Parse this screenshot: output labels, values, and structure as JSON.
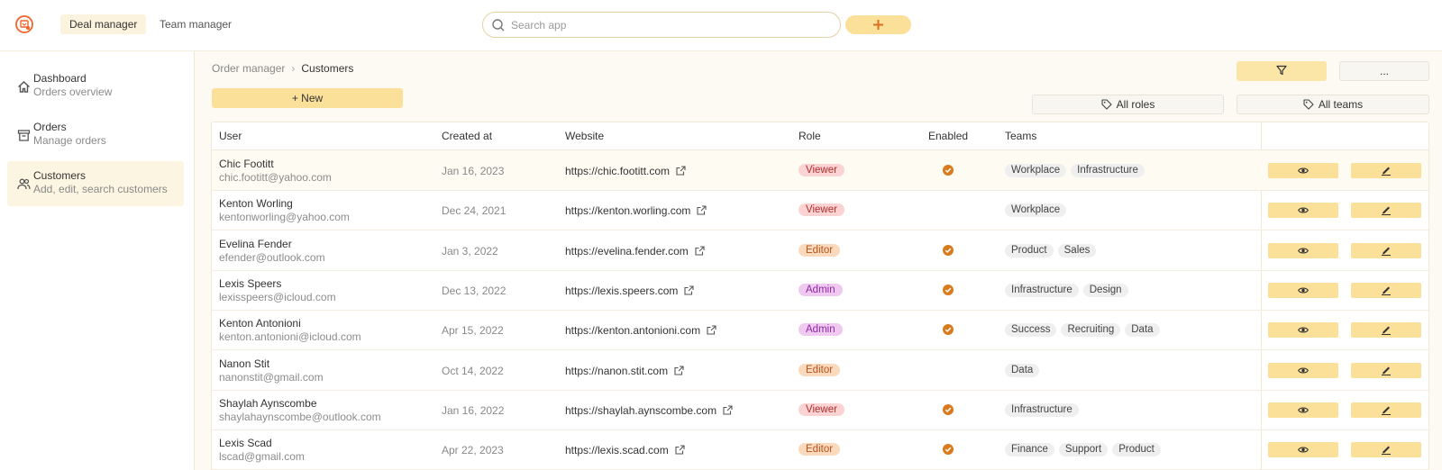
{
  "header": {
    "tabs": [
      {
        "label": "Deal manager",
        "active": true
      },
      {
        "label": "Team manager",
        "active": false
      }
    ],
    "search_placeholder": "Search app",
    "accent": "#fbe09a",
    "brand": "#f0642c"
  },
  "sidebar": {
    "items": [
      {
        "title": "Dashboard",
        "subtitle": "Orders overview",
        "icon": "home-icon",
        "active": false
      },
      {
        "title": "Orders",
        "subtitle": "Manage orders",
        "icon": "archive-icon",
        "active": false
      },
      {
        "title": "Customers",
        "subtitle": "Add, edit, search customers",
        "icon": "users-icon",
        "active": true
      }
    ]
  },
  "breadcrumb": {
    "parent": "Order manager",
    "separator": "›",
    "current": "Customers"
  },
  "toolbar": {
    "more_label": "...",
    "new_label": "+ New",
    "roles_label": "All roles",
    "teams_label": "All teams"
  },
  "table": {
    "columns": [
      "User",
      "Created at",
      "Website",
      "Role",
      "Enabled",
      "Teams"
    ],
    "rows": [
      {
        "name": "Chic Footitt",
        "email": "chic.footitt@yahoo.com",
        "created": "Jan 16, 2023",
        "website": "https://chic.footitt.com",
        "role": "Viewer",
        "enabled": true,
        "teams": [
          "Workplace",
          "Infrastructure"
        ]
      },
      {
        "name": "Kenton Worling",
        "email": "kentonworling@yahoo.com",
        "created": "Dec 24, 2021",
        "website": "https://kenton.worling.com",
        "role": "Viewer",
        "enabled": false,
        "teams": [
          "Workplace"
        ]
      },
      {
        "name": "Evelina Fender",
        "email": "efender@outlook.com",
        "created": "Jan 3, 2022",
        "website": "https://evelina.fender.com",
        "role": "Editor",
        "enabled": true,
        "teams": [
          "Product",
          "Sales"
        ]
      },
      {
        "name": "Lexis Speers",
        "email": "lexisspeers@icloud.com",
        "created": "Dec 13, 2022",
        "website": "https://lexis.speers.com",
        "role": "Admin",
        "enabled": true,
        "teams": [
          "Infrastructure",
          "Design"
        ]
      },
      {
        "name": "Kenton Antonioni",
        "email": "kenton.antonioni@icloud.com",
        "created": "Apr 15, 2022",
        "website": "https://kenton.antonioni.com",
        "role": "Admin",
        "enabled": true,
        "teams": [
          "Success",
          "Recruiting",
          "Data"
        ]
      },
      {
        "name": "Nanon Stit",
        "email": "nanonstit@gmail.com",
        "created": "Oct 14, 2022",
        "website": "https://nanon.stit.com",
        "role": "Editor",
        "enabled": false,
        "teams": [
          "Data"
        ]
      },
      {
        "name": "Shaylah Aynscombe",
        "email": "shaylahaynscombe@outlook.com",
        "created": "Jan 16, 2022",
        "website": "https://shaylah.aynscombe.com",
        "role": "Viewer",
        "enabled": true,
        "teams": [
          "Infrastructure"
        ]
      },
      {
        "name": "Lexis Scad",
        "email": "lscad@gmail.com",
        "created": "Apr 22, 2023",
        "website": "https://lexis.scad.com",
        "role": "Editor",
        "enabled": true,
        "teams": [
          "Finance",
          "Support",
          "Product"
        ]
      }
    ]
  }
}
